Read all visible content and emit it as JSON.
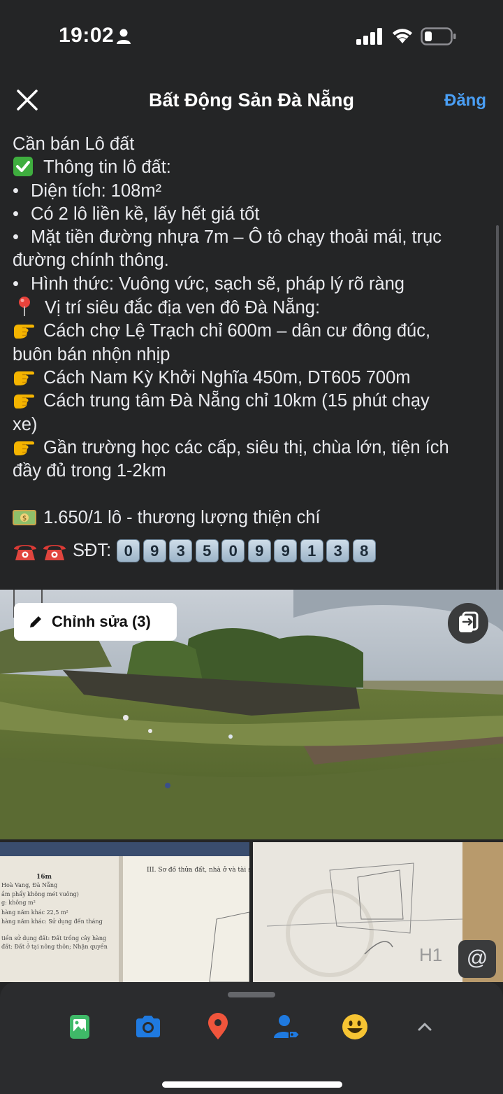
{
  "status_bar": {
    "time": "19:02"
  },
  "header": {
    "title": "Bất Động Sản Đà Nẵng",
    "post_label": "Đăng"
  },
  "post": {
    "line1": "Cần bán Lô đất",
    "line2": "Thông tin lô đất:",
    "bullet_symbol": "•",
    "b1": "Diện tích: 108m²",
    "b2": "Có 2 lô liền kề, lấy hết giá tốt",
    "b3": "Mặt tiền đường nhựa 7m – Ô tô chạy thoải mái, trục",
    "b3b": "đường chính thông.",
    "b4": "Hình thức: Vuông vức, sạch sẽ, pháp lý rõ ràng",
    "loc": "Vị trí siêu đắc địa ven đô Đà Nẵng:",
    "p1a": "Cách chợ Lệ Trạch chỉ 600m – dân cư đông đúc,",
    "p1b": "buôn bán nhộn nhịp",
    "p2": "Cách Nam Kỳ Khởi Nghĩa 450m, DT605 700m",
    "p3a": "Cách trung tâm Đà Nẵng chỉ 10km (15 phút chạy",
    "p3b": "xe)",
    "p4a": "Gần trường học các cấp, siêu thị, chùa lớn, tiện ích",
    "p4b": "đầy đủ trong 1-2km",
    "price": "1.650/1 lô - thương lượng thiện chí",
    "sdt_label": "SĐT:",
    "phone_digits": [
      "0",
      "9",
      "3",
      "5",
      "0",
      "9",
      "9",
      "1",
      "3",
      "8"
    ]
  },
  "media": {
    "edit_label": "Chỉnh sửa (3)",
    "doc_title": "III. Sơ đồ thửa đất, nhà ở và tài s",
    "doc_lines": [
      "16m",
      "Hoà Vang, Đà Nẵng",
      "ầm phẩy không mét vuông)",
      "g: không   m²",
      "hàng năm khác 22,5 m²",
      "hàng năm khác: Sử dụng đến tháng",
      "tiền sử dụng đất: Đất trồng cây hàng",
      "đất: Đất ở tại nông thôn; Nhận quyền"
    ],
    "h1_label": "H1",
    "mention_label": "@"
  },
  "colors": {
    "background": "#242526",
    "accent": "#4a9ff5",
    "tray": "#2b2c2e"
  },
  "toolbar_icons": [
    "photo-icon",
    "camera-icon",
    "location-pin-icon",
    "tag-people-icon",
    "emoji-icon",
    "chevron-up-icon"
  ]
}
